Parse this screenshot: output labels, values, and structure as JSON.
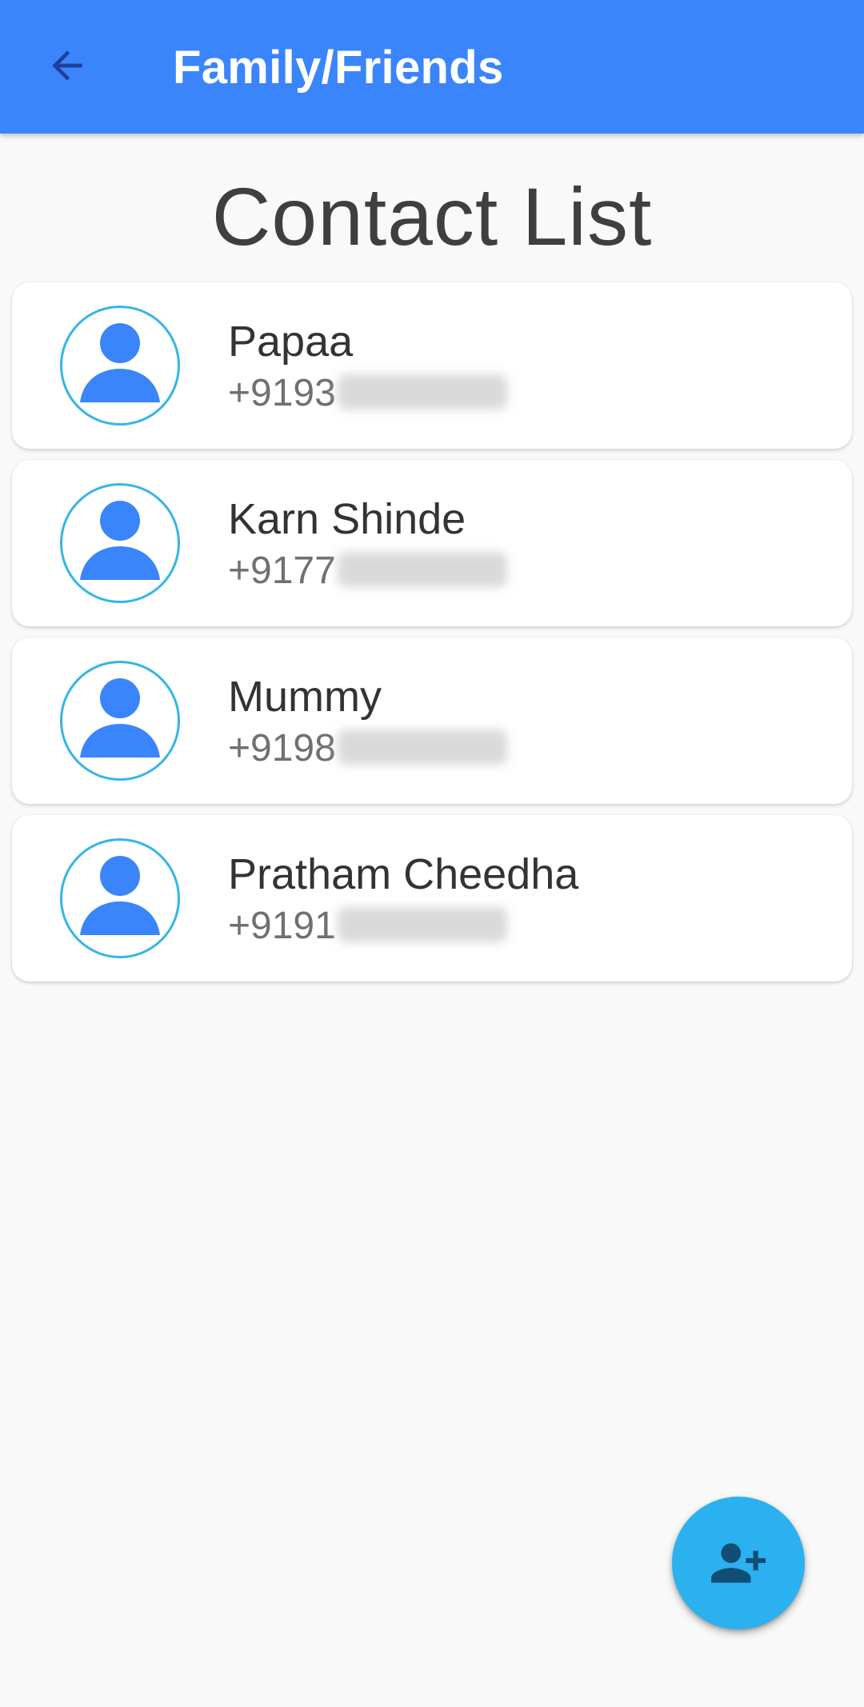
{
  "app_bar": {
    "title": "Family/Friends",
    "background_color": "#3a85fb",
    "back_icon": "arrow-back-icon"
  },
  "page": {
    "heading": "Contact List"
  },
  "contacts": [
    {
      "name": "Papaa",
      "phone_prefix": "+9193"
    },
    {
      "name": "Karn Shinde",
      "phone_prefix": "+9177"
    },
    {
      "name": "Mummy",
      "phone_prefix": "+9198"
    },
    {
      "name": "Pratham Cheedha",
      "phone_prefix": "+9191"
    }
  ],
  "avatar": {
    "icon": "person-icon",
    "color": "#3a85fb",
    "ring_color": "#35b5e8"
  },
  "fab": {
    "icon": "person-add-icon",
    "color": "#2bb0f0"
  }
}
